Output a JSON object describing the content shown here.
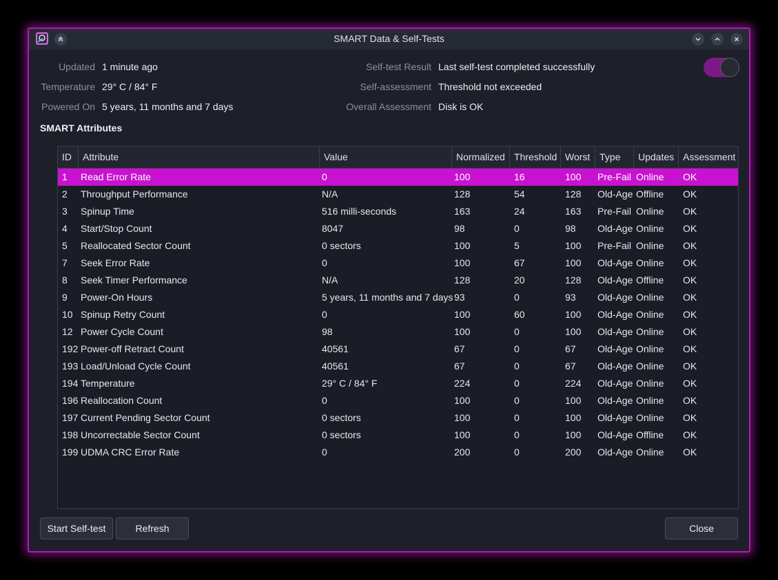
{
  "window": {
    "title": "SMART Data & Self-Tests"
  },
  "info": {
    "updated_label": "Updated",
    "updated_value": "1 minute ago",
    "temperature_label": "Temperature",
    "temperature_value": "29° C / 84° F",
    "powered_on_label": "Powered On",
    "powered_on_value": "5 years, 11 months and 7 days",
    "selftest_result_label": "Self-test Result",
    "selftest_result_value": "Last self-test completed successfully",
    "self_assessment_label": "Self-assessment",
    "self_assessment_value": "Threshold not exceeded",
    "overall_assessment_label": "Overall Assessment",
    "overall_assessment_value": "Disk is OK",
    "toggle_on": true
  },
  "section_title": "SMART Attributes",
  "table": {
    "columns": [
      "ID",
      "Attribute",
      "Value",
      "Normalized",
      "Threshold",
      "Worst",
      "Type",
      "Updates",
      "Assessment"
    ],
    "selected_row": 0,
    "rows": [
      [
        "1",
        "Read Error Rate",
        "0",
        "100",
        "16",
        "100",
        "Pre-Fail",
        "Online",
        "OK"
      ],
      [
        "2",
        "Throughput Performance",
        "N/A",
        "128",
        "54",
        "128",
        "Old-Age",
        "Offline",
        "OK"
      ],
      [
        "3",
        "Spinup Time",
        "516 milli-seconds",
        "163",
        "24",
        "163",
        "Pre-Fail",
        "Online",
        "OK"
      ],
      [
        "4",
        "Start/Stop Count",
        "8047",
        "98",
        "0",
        "98",
        "Old-Age",
        "Online",
        "OK"
      ],
      [
        "5",
        "Reallocated Sector Count",
        "0 sectors",
        "100",
        "5",
        "100",
        "Pre-Fail",
        "Online",
        "OK"
      ],
      [
        "7",
        "Seek Error Rate",
        "0",
        "100",
        "67",
        "100",
        "Old-Age",
        "Online",
        "OK"
      ],
      [
        "8",
        "Seek Timer Performance",
        "N/A",
        "128",
        "20",
        "128",
        "Old-Age",
        "Offline",
        "OK"
      ],
      [
        "9",
        "Power-On Hours",
        "5 years, 11 months and 7 days",
        "93",
        "0",
        "93",
        "Old-Age",
        "Online",
        "OK"
      ],
      [
        "10",
        "Spinup Retry Count",
        "0",
        "100",
        "60",
        "100",
        "Old-Age",
        "Online",
        "OK"
      ],
      [
        "12",
        "Power Cycle Count",
        "98",
        "100",
        "0",
        "100",
        "Old-Age",
        "Online",
        "OK"
      ],
      [
        "192",
        "Power-off Retract Count",
        "40561",
        "67",
        "0",
        "67",
        "Old-Age",
        "Online",
        "OK"
      ],
      [
        "193",
        "Load/Unload Cycle Count",
        "40561",
        "67",
        "0",
        "67",
        "Old-Age",
        "Online",
        "OK"
      ],
      [
        "194",
        "Temperature",
        "29° C / 84° F",
        "224",
        "0",
        "224",
        "Old-Age",
        "Online",
        "OK"
      ],
      [
        "196",
        "Reallocation Count",
        "0",
        "100",
        "0",
        "100",
        "Old-Age",
        "Online",
        "OK"
      ],
      [
        "197",
        "Current Pending Sector Count",
        "0 sectors",
        "100",
        "0",
        "100",
        "Old-Age",
        "Online",
        "OK"
      ],
      [
        "198",
        "Uncorrectable Sector Count",
        "0 sectors",
        "100",
        "0",
        "100",
        "Old-Age",
        "Offline",
        "OK"
      ],
      [
        "199",
        "UDMA CRC Error Rate",
        "0",
        "200",
        "0",
        "200",
        "Old-Age",
        "Online",
        "OK"
      ]
    ]
  },
  "buttons": {
    "start_selftest": "Start Self-test",
    "refresh": "Refresh",
    "close": "Close"
  },
  "icons": {
    "app": "disk-monitor-icon",
    "shade": "keep-above-icon",
    "minimize": "chevron-down-icon",
    "maximize": "chevron-up-icon",
    "close": "close-icon"
  },
  "colors": {
    "accent": "#c812cf",
    "window_border": "#b01ab0",
    "background": "#1d2029"
  }
}
